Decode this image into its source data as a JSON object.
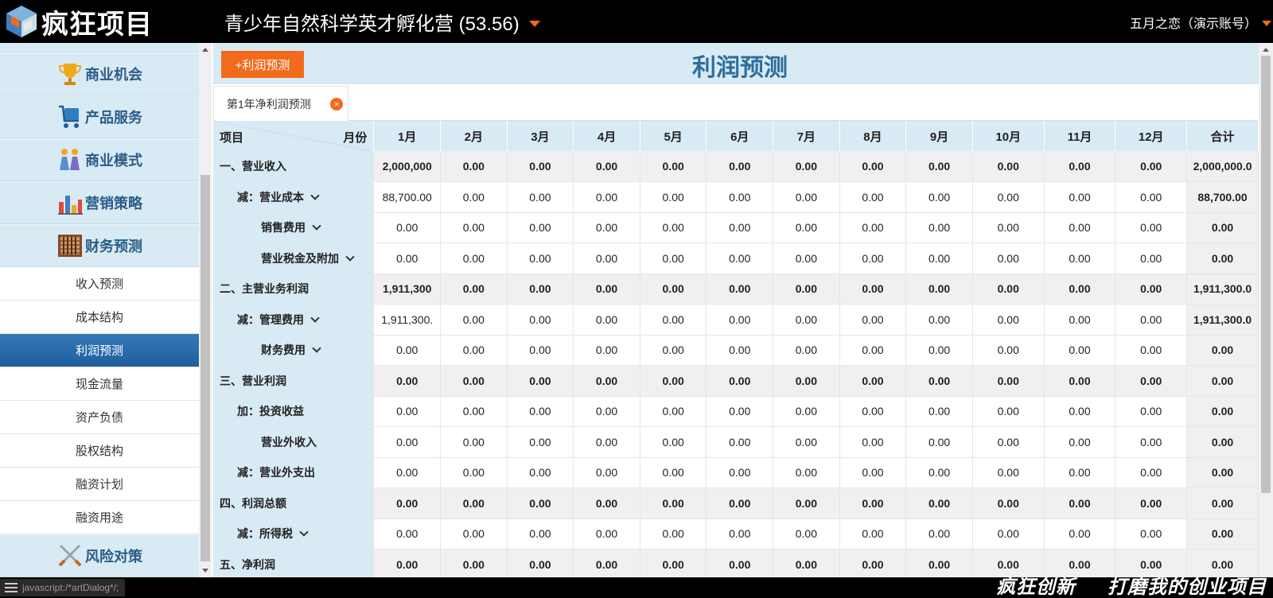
{
  "topbar": {
    "logo_text": "疯狂项目",
    "project_title": "青少年自然科学英才孵化营 (53.56)",
    "user": "五月之恋（演示账号）"
  },
  "sidebar": {
    "categories_top": [
      {
        "label": "商业机会",
        "icon": "trophy-icon"
      },
      {
        "label": "产品服务",
        "icon": "cart-icon"
      },
      {
        "label": "商业模式",
        "icon": "people-icon"
      },
      {
        "label": "营销策略",
        "icon": "bar-chart-icon"
      },
      {
        "label": "财务预测",
        "icon": "abacus-icon"
      }
    ],
    "sub_items": [
      "收入预测",
      "成本结构",
      "利润预测",
      "现金流量",
      "资产负债",
      "股权结构",
      "融资计划",
      "融资用途"
    ],
    "active_sub": "利润预测",
    "category_bottom": {
      "label": "风险对策",
      "icon": "swords-icon"
    }
  },
  "main": {
    "add_button": "+利润预测",
    "title": "利润预测",
    "tab": {
      "label": "第1年净利润预测",
      "close": "×"
    }
  },
  "table": {
    "header_item": "项目",
    "header_month": "月份",
    "columns": [
      "1月",
      "2月",
      "3月",
      "4月",
      "5月",
      "6月",
      "7月",
      "8月",
      "9月",
      "10月",
      "11月",
      "12月",
      "合计"
    ],
    "rows": [
      {
        "label": "一、营业收入",
        "indent": 0,
        "chev": false,
        "hl": true,
        "values": [
          "2,000,000",
          "0.00",
          "0.00",
          "0.00",
          "0.00",
          "0.00",
          "0.00",
          "0.00",
          "0.00",
          "0.00",
          "0.00",
          "0.00",
          "2,000,000.0"
        ]
      },
      {
        "label": "减：营业成本",
        "indent": 1,
        "chev": true,
        "hl": false,
        "values": [
          "88,700.00",
          "0.00",
          "0.00",
          "0.00",
          "0.00",
          "0.00",
          "0.00",
          "0.00",
          "0.00",
          "0.00",
          "0.00",
          "0.00",
          "88,700.00"
        ]
      },
      {
        "label": "销售费用",
        "indent": 2,
        "chev": true,
        "hl": false,
        "values": [
          "0.00",
          "0.00",
          "0.00",
          "0.00",
          "0.00",
          "0.00",
          "0.00",
          "0.00",
          "0.00",
          "0.00",
          "0.00",
          "0.00",
          "0.00"
        ]
      },
      {
        "label": "营业税金及附加",
        "indent": 2,
        "chev": true,
        "hl": false,
        "values": [
          "0.00",
          "0.00",
          "0.00",
          "0.00",
          "0.00",
          "0.00",
          "0.00",
          "0.00",
          "0.00",
          "0.00",
          "0.00",
          "0.00",
          "0.00"
        ]
      },
      {
        "label": "二、主营业务利润",
        "indent": 0,
        "chev": false,
        "hl": true,
        "values": [
          "1,911,300",
          "0.00",
          "0.00",
          "0.00",
          "0.00",
          "0.00",
          "0.00",
          "0.00",
          "0.00",
          "0.00",
          "0.00",
          "0.00",
          "1,911,300.0"
        ]
      },
      {
        "label": "减：管理费用",
        "indent": 1,
        "chev": true,
        "hl": false,
        "values": [
          "1,911,300.",
          "0.00",
          "0.00",
          "0.00",
          "0.00",
          "0.00",
          "0.00",
          "0.00",
          "0.00",
          "0.00",
          "0.00",
          "0.00",
          "1,911,300.0"
        ]
      },
      {
        "label": "财务费用",
        "indent": 2,
        "chev": true,
        "hl": false,
        "values": [
          "0.00",
          "0.00",
          "0.00",
          "0.00",
          "0.00",
          "0.00",
          "0.00",
          "0.00",
          "0.00",
          "0.00",
          "0.00",
          "0.00",
          "0.00"
        ]
      },
      {
        "label": "三、营业利润",
        "indent": 0,
        "chev": false,
        "hl": true,
        "values": [
          "0.00",
          "0.00",
          "0.00",
          "0.00",
          "0.00",
          "0.00",
          "0.00",
          "0.00",
          "0.00",
          "0.00",
          "0.00",
          "0.00",
          "0.00"
        ]
      },
      {
        "label": "加：投资收益",
        "indent": 1,
        "chev": false,
        "hl": false,
        "values": [
          "0.00",
          "0.00",
          "0.00",
          "0.00",
          "0.00",
          "0.00",
          "0.00",
          "0.00",
          "0.00",
          "0.00",
          "0.00",
          "0.00",
          "0.00"
        ]
      },
      {
        "label": "营业外收入",
        "indent": 2,
        "chev": false,
        "hl": false,
        "values": [
          "0.00",
          "0.00",
          "0.00",
          "0.00",
          "0.00",
          "0.00",
          "0.00",
          "0.00",
          "0.00",
          "0.00",
          "0.00",
          "0.00",
          "0.00"
        ]
      },
      {
        "label": "减：营业外支出",
        "indent": 1,
        "chev": false,
        "hl": false,
        "values": [
          "0.00",
          "0.00",
          "0.00",
          "0.00",
          "0.00",
          "0.00",
          "0.00",
          "0.00",
          "0.00",
          "0.00",
          "0.00",
          "0.00",
          "0.00"
        ]
      },
      {
        "label": "四、利润总额",
        "indent": 0,
        "chev": false,
        "hl": true,
        "values": [
          "0.00",
          "0.00",
          "0.00",
          "0.00",
          "0.00",
          "0.00",
          "0.00",
          "0.00",
          "0.00",
          "0.00",
          "0.00",
          "0.00",
          "0.00"
        ]
      },
      {
        "label": "减：所得税",
        "indent": 1,
        "chev": true,
        "hl": false,
        "values": [
          "0.00",
          "0.00",
          "0.00",
          "0.00",
          "0.00",
          "0.00",
          "0.00",
          "0.00",
          "0.00",
          "0.00",
          "0.00",
          "0.00",
          "0.00"
        ]
      },
      {
        "label": "五、净利润",
        "indent": 0,
        "chev": false,
        "hl": true,
        "values": [
          "0.00",
          "0.00",
          "0.00",
          "0.00",
          "0.00",
          "0.00",
          "0.00",
          "0.00",
          "0.00",
          "0.00",
          "0.00",
          "0.00",
          "0.00"
        ]
      }
    ]
  },
  "footer": {
    "status_text": "javascript:/*artDialog*/;",
    "slogan_1": "疯狂创新",
    "slogan_2": "打磨我的创业项目"
  },
  "colors": {
    "accent": "#f26a1b",
    "panel": "#d8eaf4",
    "active": "#2a6aa8",
    "title": "#2e6f9a"
  }
}
